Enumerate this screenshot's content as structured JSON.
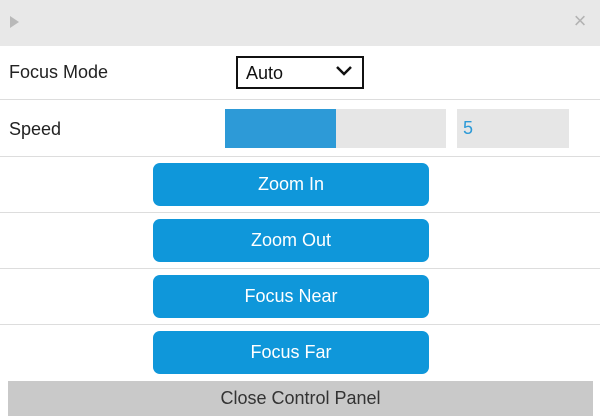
{
  "titlebar": {
    "play_icon": "play-triangle-icon",
    "close_icon": "close-icon",
    "close_glyph": "×"
  },
  "focus_mode": {
    "label": "Focus Mode",
    "selected": "Auto",
    "dropdown_icon": "chevron-down-icon"
  },
  "speed": {
    "label": "Speed",
    "value": "5",
    "level_fraction": 0.5
  },
  "buttons": {
    "zoom_in": "Zoom In",
    "zoom_out": "Zoom Out",
    "focus_near": "Focus Near",
    "focus_far": "Focus Far"
  },
  "footer": {
    "close_label": "Close Control Panel"
  },
  "colors": {
    "accent": "#0f97da",
    "slider_fill": "#2d9ad7",
    "titlebar_bg": "#e8e8e8",
    "footer_bg": "#c9c9c9"
  }
}
